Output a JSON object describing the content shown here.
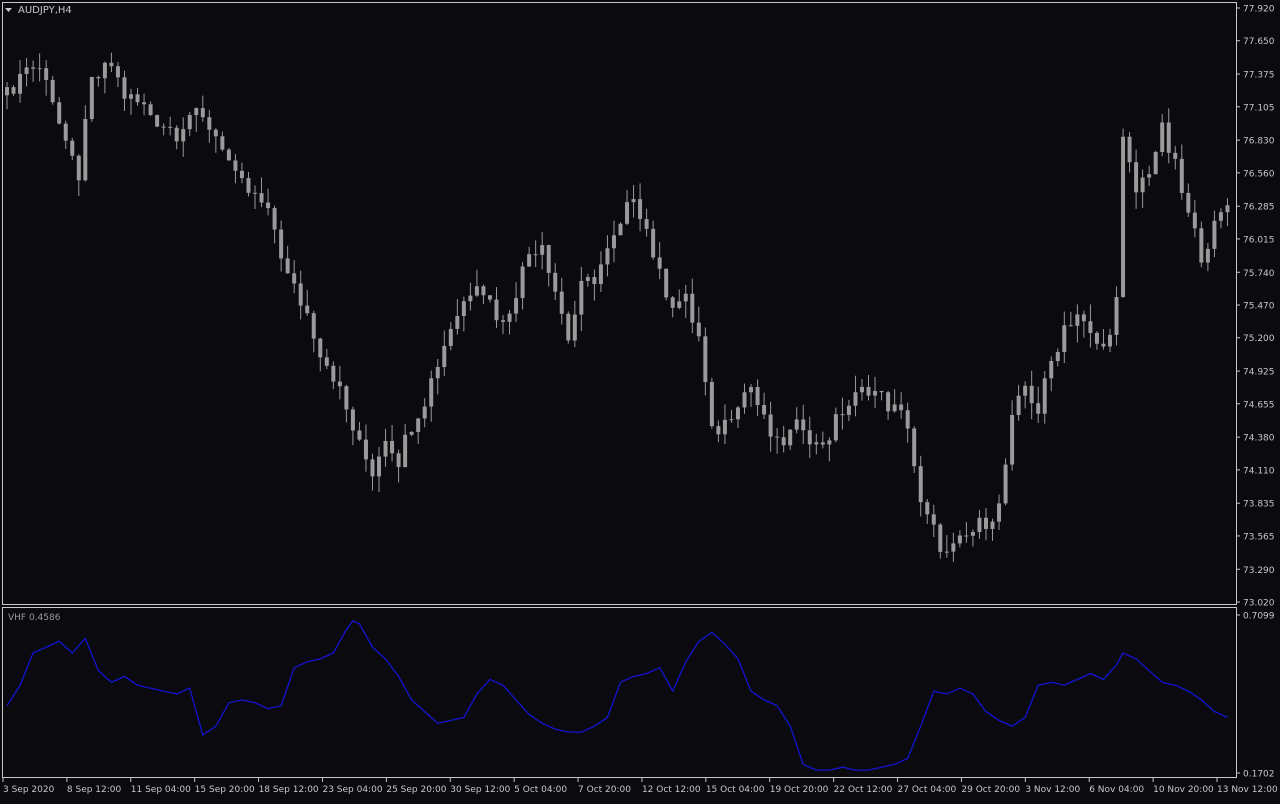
{
  "window": {
    "symbol_title": "AUDJPY,H4"
  },
  "colors": {
    "background": "#0a0a0f",
    "frame": "#c8c8c8",
    "candle": "#9a9a9a",
    "indicator_line": "#1414d2",
    "text": "#c8c8c8"
  },
  "icons": {
    "title_dropdown": "triangle-down-icon"
  },
  "chart_data": [
    {
      "type": "candlestick",
      "title": "AUDJPY,H4",
      "ylim": [
        73.02,
        77.92
      ],
      "y_ticks": [
        "77.920",
        "77.650",
        "77.375",
        "77.105",
        "76.830",
        "76.560",
        "76.285",
        "76.015",
        "75.740",
        "75.470",
        "75.200",
        "74.925",
        "74.655",
        "74.380",
        "74.110",
        "73.835",
        "73.565",
        "73.290",
        "73.020"
      ],
      "x_ticks": [
        "3 Sep 2020",
        "8 Sep 12:00",
        "11 Sep 04:00",
        "15 Sep 20:00",
        "18 Sep 12:00",
        "23 Sep 04:00",
        "25 Sep 20:00",
        "30 Sep 12:00",
        "5 Oct 04:00",
        "7 Oct 20:00",
        "12 Oct 12:00",
        "15 Oct 04:00",
        "19 Oct 20:00",
        "22 Oct 12:00",
        "27 Oct 04:00",
        "29 Oct 20:00",
        "3 Nov 12:00",
        "6 Nov 04:00",
        "10 Nov 20:00",
        "13 Nov 12:00"
      ],
      "grid": false,
      "close_path": [
        [
          0,
          77.2
        ],
        [
          3,
          77.45
        ],
        [
          6,
          77.38
        ],
        [
          9,
          76.75
        ],
        [
          11,
          76.55
        ],
        [
          13,
          77.3
        ],
        [
          16,
          77.45
        ],
        [
          18,
          77.2
        ],
        [
          21,
          77.1
        ],
        [
          23,
          77.0
        ],
        [
          26,
          76.9
        ],
        [
          28,
          77.05
        ],
        [
          31,
          76.95
        ],
        [
          33,
          76.8
        ],
        [
          35,
          76.5
        ],
        [
          37,
          76.4
        ],
        [
          39,
          76.3
        ],
        [
          41,
          76.1
        ],
        [
          43,
          75.7
        ],
        [
          46,
          75.4
        ],
        [
          48,
          75.1
        ],
        [
          50,
          74.9
        ],
        [
          52,
          74.6
        ],
        [
          54,
          74.3
        ],
        [
          56,
          74.1
        ],
        [
          58,
          74.4
        ],
        [
          60,
          74.2
        ],
        [
          62,
          74.5
        ],
        [
          64,
          74.7
        ],
        [
          66,
          75.0
        ],
        [
          68,
          75.3
        ],
        [
          70,
          75.5
        ],
        [
          72,
          75.7
        ],
        [
          74,
          75.5
        ],
        [
          76,
          75.3
        ],
        [
          78,
          75.6
        ],
        [
          80,
          75.9
        ],
        [
          82,
          76.0
        ],
        [
          84,
          75.6
        ],
        [
          86,
          75.2
        ],
        [
          88,
          75.6
        ],
        [
          90,
          75.7
        ],
        [
          92,
          75.9
        ],
        [
          94,
          76.1
        ],
        [
          96,
          76.4
        ],
        [
          98,
          76.1
        ],
        [
          100,
          75.7
        ],
        [
          102,
          75.5
        ],
        [
          104,
          75.5
        ],
        [
          106,
          75.2
        ],
        [
          108,
          74.4
        ],
        [
          110,
          74.5
        ],
        [
          112,
          74.7
        ],
        [
          114,
          74.8
        ],
        [
          116,
          74.5
        ],
        [
          118,
          74.3
        ],
        [
          120,
          74.4
        ],
        [
          122,
          74.5
        ],
        [
          124,
          74.3
        ],
        [
          126,
          74.4
        ],
        [
          128,
          74.6
        ],
        [
          130,
          74.7
        ],
        [
          132,
          74.8
        ],
        [
          134,
          74.7
        ],
        [
          136,
          74.6
        ],
        [
          138,
          74.5
        ],
        [
          140,
          73.8
        ],
        [
          142,
          73.6
        ],
        [
          144,
          73.4
        ],
        [
          146,
          73.5
        ],
        [
          148,
          73.6
        ],
        [
          150,
          73.7
        ],
        [
          152,
          73.8
        ],
        [
          154,
          74.5
        ],
        [
          156,
          74.8
        ],
        [
          158,
          74.6
        ],
        [
          160,
          75.0
        ],
        [
          162,
          75.3
        ],
        [
          164,
          75.4
        ],
        [
          166,
          75.2
        ],
        [
          168,
          75.1
        ],
        [
          170,
          75.5
        ],
        [
          171,
          76.8
        ],
        [
          173,
          76.4
        ],
        [
          175,
          76.6
        ],
        [
          177,
          76.9
        ],
        [
          179,
          76.6
        ],
        [
          181,
          76.2
        ],
        [
          183,
          75.9
        ],
        [
          185,
          76.1
        ],
        [
          187,
          76.3
        ]
      ]
    },
    {
      "type": "line",
      "title": "VHF 0.4586",
      "ylim": [
        0.1702,
        0.7099
      ],
      "y_ticks": [
        "0.7099",
        "0.1702"
      ],
      "grid": false,
      "series": [
        {
          "name": "VHF 0.4586",
          "points": [
            [
              0,
              0.4
            ],
            [
              2,
              0.47
            ],
            [
              4,
              0.58
            ],
            [
              6,
              0.6
            ],
            [
              8,
              0.62
            ],
            [
              10,
              0.58
            ],
            [
              12,
              0.63
            ],
            [
              14,
              0.52
            ],
            [
              16,
              0.48
            ],
            [
              18,
              0.5
            ],
            [
              20,
              0.47
            ],
            [
              22,
              0.46
            ],
            [
              24,
              0.45
            ],
            [
              26,
              0.44
            ],
            [
              28,
              0.46
            ],
            [
              30,
              0.3
            ],
            [
              32,
              0.33
            ],
            [
              34,
              0.41
            ],
            [
              36,
              0.42
            ],
            [
              38,
              0.41
            ],
            [
              40,
              0.39
            ],
            [
              42,
              0.4
            ],
            [
              44,
              0.53
            ],
            [
              46,
              0.55
            ],
            [
              48,
              0.56
            ],
            [
              50,
              0.58
            ],
            [
              52,
              0.66
            ],
            [
              53,
              0.69
            ],
            [
              54,
              0.68
            ],
            [
              56,
              0.6
            ],
            [
              58,
              0.56
            ],
            [
              60,
              0.5
            ],
            [
              62,
              0.42
            ],
            [
              64,
              0.38
            ],
            [
              66,
              0.34
            ],
            [
              68,
              0.35
            ],
            [
              70,
              0.36
            ],
            [
              72,
              0.44
            ],
            [
              74,
              0.49
            ],
            [
              76,
              0.47
            ],
            [
              78,
              0.42
            ],
            [
              80,
              0.37
            ],
            [
              82,
              0.34
            ],
            [
              84,
              0.32
            ],
            [
              86,
              0.31
            ],
            [
              88,
              0.31
            ],
            [
              90,
              0.33
            ],
            [
              92,
              0.36
            ],
            [
              94,
              0.48
            ],
            [
              96,
              0.5
            ],
            [
              98,
              0.51
            ],
            [
              100,
              0.53
            ],
            [
              102,
              0.45
            ],
            [
              104,
              0.55
            ],
            [
              106,
              0.62
            ],
            [
              108,
              0.65
            ],
            [
              110,
              0.61
            ],
            [
              112,
              0.56
            ],
            [
              114,
              0.45
            ],
            [
              116,
              0.42
            ],
            [
              118,
              0.4
            ],
            [
              120,
              0.33
            ],
            [
              122,
              0.2
            ],
            [
              124,
              0.18
            ],
            [
              126,
              0.18
            ],
            [
              128,
              0.19
            ],
            [
              130,
              0.18
            ],
            [
              132,
              0.18
            ],
            [
              134,
              0.19
            ],
            [
              136,
              0.2
            ],
            [
              138,
              0.22
            ],
            [
              140,
              0.33
            ],
            [
              142,
              0.45
            ],
            [
              144,
              0.44
            ],
            [
              146,
              0.46
            ],
            [
              148,
              0.44
            ],
            [
              150,
              0.38
            ],
            [
              152,
              0.35
            ],
            [
              154,
              0.33
            ],
            [
              156,
              0.36
            ],
            [
              158,
              0.47
            ],
            [
              160,
              0.48
            ],
            [
              162,
              0.47
            ],
            [
              164,
              0.49
            ],
            [
              166,
              0.51
            ],
            [
              168,
              0.49
            ],
            [
              170,
              0.54
            ],
            [
              171,
              0.58
            ],
            [
              173,
              0.56
            ],
            [
              175,
              0.52
            ],
            [
              177,
              0.48
            ],
            [
              179,
              0.47
            ],
            [
              181,
              0.45
            ],
            [
              183,
              0.42
            ],
            [
              185,
              0.38
            ],
            [
              187,
              0.36
            ]
          ]
        }
      ]
    }
  ]
}
